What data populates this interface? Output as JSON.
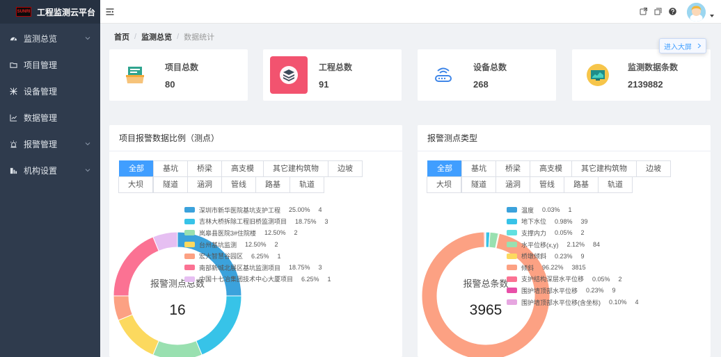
{
  "app": {
    "logo_text": "SUNRI",
    "title": "工程监测云平台"
  },
  "sidebar": {
    "items": [
      {
        "label": "监测总览",
        "icon": "dashboard-icon",
        "has_children": true
      },
      {
        "label": "项目管理",
        "icon": "folder-icon",
        "has_children": false
      },
      {
        "label": "设备管理",
        "icon": "devices-icon",
        "has_children": false
      },
      {
        "label": "数据管理",
        "icon": "line-chart-icon",
        "has_children": false
      },
      {
        "label": "报警管理",
        "icon": "alarm-icon",
        "has_children": true
      },
      {
        "label": "机构设置",
        "icon": "org-icon",
        "has_children": true
      }
    ]
  },
  "breadcrumb": [
    "首页",
    "监测总览",
    "数据统计"
  ],
  "bigscreen": {
    "label": "进入大屏"
  },
  "stats": [
    {
      "label": "项目总数",
      "value": "80",
      "icon": "project-board-icon",
      "color": "#ffffff"
    },
    {
      "label": "工程总数",
      "value": "91",
      "icon": "layers-icon",
      "color": "#f2536f"
    },
    {
      "label": "设备总数",
      "value": "268",
      "icon": "router-icon",
      "color": "#ffffff"
    },
    {
      "label": "监测数据条数",
      "value": "2139882",
      "icon": "monitor-screen-icon",
      "color": "#ffffff"
    }
  ],
  "tabs": [
    "全部",
    "基坑",
    "桥梁",
    "高支模",
    "其它建构筑物",
    "边坡",
    "大坝",
    "隧道",
    "涵洞",
    "管线",
    "路基",
    "轨道"
  ],
  "panels": [
    {
      "title": "项目报警数据比例（测点）",
      "center_label": "报警测点总数",
      "center_value": "16"
    },
    {
      "title": "报警测点类型",
      "center_label": "报警总条数",
      "center_value": "3965"
    }
  ],
  "chart_data": [
    {
      "type": "pie",
      "title": "项目报警数据比例（测点）",
      "center_label": "报警测点总数",
      "total": 16,
      "legend_position": "right",
      "slices": [
        {
          "name": "深圳市新华医院基坑支护工程",
          "percent": "25.00%",
          "value": 4,
          "color": "#3ba2dc"
        },
        {
          "name": "吉林大桥拆除工程旧桥监测项目",
          "percent": "18.75%",
          "value": 3,
          "color": "#37c3e8"
        },
        {
          "name": "岚皋县医院3#住院楼",
          "percent": "12.50%",
          "value": 2,
          "color": "#99e0b0"
        },
        {
          "name": "台州基坑监测",
          "percent": "12.50%",
          "value": 2,
          "color": "#fcd95f"
        },
        {
          "name": "宏大智慧谷园区",
          "percent": "6.25%",
          "value": 1,
          "color": "#fca183"
        },
        {
          "name": "南部新城北展区基坑监测项目",
          "percent": "18.75%",
          "value": 3,
          "color": "#fb7293"
        },
        {
          "name": "中国十七冶集团技术中心大厦项目",
          "percent": "6.25%",
          "value": 1,
          "color": "#e6bff2"
        }
      ]
    },
    {
      "type": "pie",
      "title": "报警测点类型",
      "center_label": "报警总条数",
      "total": 3965,
      "legend_position": "right",
      "slices": [
        {
          "name": "温度",
          "percent": "0.03%",
          "value": 1,
          "color": "#3ba2dc"
        },
        {
          "name": "地下水位",
          "percent": "0.98%",
          "value": 39,
          "color": "#37c3e8"
        },
        {
          "name": "支撑内力",
          "percent": "0.05%",
          "value": 2,
          "color": "#61e0e0"
        },
        {
          "name": "水平位移(x,y)",
          "percent": "2.12%",
          "value": 84,
          "color": "#99e0b0"
        },
        {
          "name": "桥墩倾斜",
          "percent": "0.23%",
          "value": 9,
          "color": "#fcd95f"
        },
        {
          "name": "倾斜",
          "percent": "96.22%",
          "value": 3815,
          "color": "#fca183"
        },
        {
          "name": "支护结构深层水平位移",
          "percent": "0.05%",
          "value": 2,
          "color": "#fb7293"
        },
        {
          "name": "围护墙顶部水平位移",
          "percent": "0.23%",
          "value": 9,
          "color": "#e84fa8"
        },
        {
          "name": "围护墙顶部水平位移(含坐标)",
          "percent": "0.10%",
          "value": 4,
          "color": "#e6a6e0"
        }
      ]
    }
  ]
}
